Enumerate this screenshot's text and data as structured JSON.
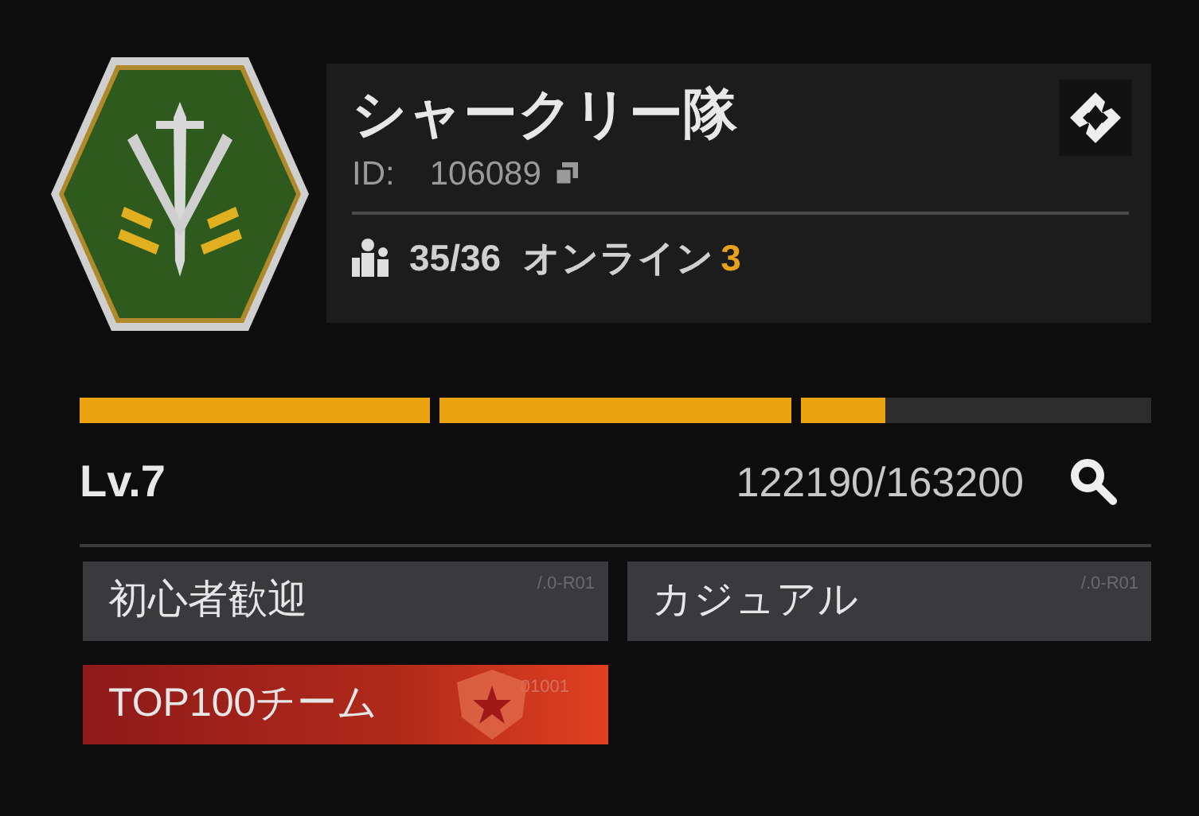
{
  "team": {
    "name": "シャークリー隊",
    "id_label": "ID:",
    "id": "106089",
    "members": "35/36",
    "online_label": "オンライン",
    "online": "3"
  },
  "progress": {
    "segments": [
      {
        "level": 1
      },
      {
        "level": 1
      },
      {
        "level": 0.24
      }
    ],
    "level_label": "Lv.7",
    "exp": "122190/163200"
  },
  "tags": [
    {
      "kind": "gray",
      "label": "初心者歓迎",
      "code": "/.0-R01"
    },
    {
      "kind": "gray",
      "label": "カジュアル",
      "code": "/.0-R01"
    },
    {
      "kind": "red",
      "label": "TOP100チーム",
      "code": "01001"
    }
  ]
}
